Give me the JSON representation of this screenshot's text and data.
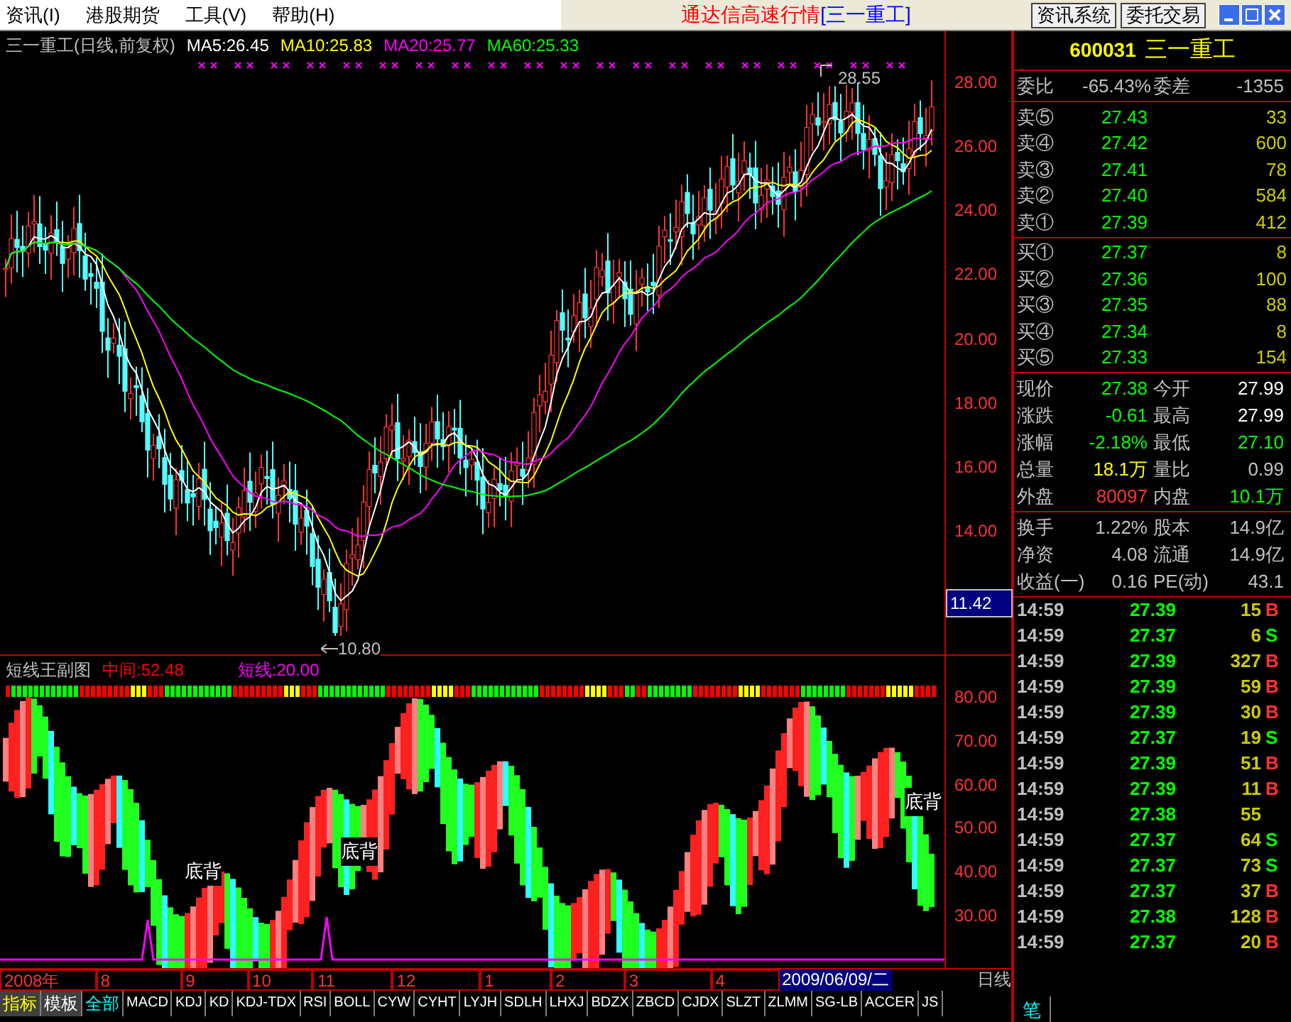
{
  "menu": [
    "资讯(I)",
    "港股期货",
    "工具(V)",
    "帮助(H)"
  ],
  "title": {
    "app": "通达信高速行情",
    "stock": "[三一重工]"
  },
  "toolbar_buttons": [
    "资讯系统",
    "委托交易"
  ],
  "main_chart": {
    "title": "三一重工(日线,前复权)",
    "ma": [
      {
        "label": "MA5:26.45",
        "color": "#ffffff"
      },
      {
        "label": "MA10:25.83",
        "color": "#ffff00"
      },
      {
        "label": "MA20:25.77",
        "color": "#ff00ff"
      },
      {
        "label": "MA60:25.33",
        "color": "#00ff00"
      }
    ],
    "high_label": "28.55",
    "low_label": "10.80",
    "yticks": [
      "28.00",
      "26.00",
      "24.00",
      "22.00",
      "20.00",
      "18.00",
      "16.00",
      "14.00"
    ],
    "cursor_value": "11.42"
  },
  "sub_chart": {
    "title": "短线王副图",
    "values": [
      {
        "label": "中间:52.48",
        "color": "#ff0000"
      },
      {
        "label": "短线:20.00",
        "color": "#ff00ff"
      }
    ],
    "annotations": [
      "底背",
      "底背",
      "底背"
    ],
    "yticks": [
      "80.00",
      "70.00",
      "60.00",
      "50.00",
      "40.00",
      "30.00"
    ]
  },
  "date_axis": {
    "labels": [
      "2008年",
      "8",
      "9",
      "10",
      "11",
      "12",
      "1",
      "2",
      "3",
      "4"
    ],
    "cursor_date": "2009/06/09/二",
    "period": "日线"
  },
  "tabs": [
    {
      "label": "指标",
      "kind": "group",
      "selected": false
    },
    {
      "label": "模板",
      "kind": "group",
      "selected": false
    },
    {
      "label": "全部",
      "kind": "indicator",
      "selected": true
    },
    {
      "label": "MACD",
      "kind": "indicator",
      "selected": false
    },
    {
      "label": "KDJ",
      "kind": "indicator",
      "selected": false
    },
    {
      "label": "KD",
      "kind": "indicator",
      "selected": false
    },
    {
      "label": "KDJ-TDX",
      "kind": "indicator",
      "selected": false
    },
    {
      "label": "RSI",
      "kind": "indicator",
      "selected": false
    },
    {
      "label": "BOLL",
      "kind": "indicator",
      "selected": false
    },
    {
      "label": "CYW",
      "kind": "indicator",
      "selected": false
    },
    {
      "label": "CYHT",
      "kind": "indicator",
      "selected": false
    },
    {
      "label": "LYJH",
      "kind": "indicator",
      "selected": false
    },
    {
      "label": "SDLH",
      "kind": "indicator",
      "selected": false
    },
    {
      "label": "LHXJ",
      "kind": "indicator",
      "selected": false
    },
    {
      "label": "BDZX",
      "kind": "indicator",
      "selected": false
    },
    {
      "label": "ZBCD",
      "kind": "indicator",
      "selected": false
    },
    {
      "label": "CJDX",
      "kind": "indicator",
      "selected": false
    },
    {
      "label": "SLZT",
      "kind": "indicator",
      "selected": false
    },
    {
      "label": "ZLMM",
      "kind": "indicator",
      "selected": false
    },
    {
      "label": "SG-LB",
      "kind": "indicator",
      "selected": false
    },
    {
      "label": "ACCER",
      "kind": "indicator",
      "selected": false
    },
    {
      "label": "JS",
      "kind": "indicator",
      "selected": false
    }
  ],
  "quote": {
    "code": "600031",
    "name": "三一重工",
    "ratio": {
      "label": "委比",
      "value": "-65.43%",
      "label2": "委差",
      "value2": "-1355"
    },
    "asks": [
      {
        "label": "卖⑤",
        "price": "27.43",
        "volume": "33"
      },
      {
        "label": "卖④",
        "price": "27.42",
        "volume": "600"
      },
      {
        "label": "卖③",
        "price": "27.41",
        "volume": "78"
      },
      {
        "label": "卖②",
        "price": "27.40",
        "volume": "584"
      },
      {
        "label": "卖①",
        "price": "27.39",
        "volume": "412"
      }
    ],
    "bids": [
      {
        "label": "买①",
        "price": "27.37",
        "volume": "8"
      },
      {
        "label": "买②",
        "price": "27.36",
        "volume": "100"
      },
      {
        "label": "买③",
        "price": "27.35",
        "volume": "88"
      },
      {
        "label": "买④",
        "price": "27.34",
        "volume": "8"
      },
      {
        "label": "买⑤",
        "price": "27.33",
        "volume": "154"
      }
    ],
    "stats": [
      {
        "left": {
          "label": "现价",
          "value": "27.38",
          "color": "#00ff00"
        },
        "right": {
          "label": "今开",
          "value": "27.99",
          "color": "#ffffff"
        }
      },
      {
        "left": {
          "label": "涨跌",
          "value": "-0.61",
          "color": "#00ff00"
        },
        "right": {
          "label": "最高",
          "value": "27.99",
          "color": "#ffffff"
        }
      },
      {
        "left": {
          "label": "涨幅",
          "value": "-2.18%",
          "color": "#00ff00"
        },
        "right": {
          "label": "最低",
          "value": "27.10",
          "color": "#00ff00"
        }
      },
      {
        "left": {
          "label": "总量",
          "value": "18.1万",
          "color": "#ffff00"
        },
        "right": {
          "label": "量比",
          "value": "0.99",
          "color": "#c0c0c0"
        }
      },
      {
        "left": {
          "label": "外盘",
          "value": "80097",
          "color": "#ff3232"
        },
        "right": {
          "label": "内盘",
          "value": "10.1万",
          "color": "#00ff00"
        }
      }
    ],
    "fundamentals": [
      {
        "label": "换手",
        "value": "1.22%",
        "label2": "股本",
        "value2": "14.9亿"
      },
      {
        "label": "净资",
        "value": "4.08",
        "label2": "流通",
        "value2": "14.9亿"
      },
      {
        "label": "收益(一)",
        "value": "0.16",
        "label2": "PE(动)",
        "value2": "43.1"
      }
    ]
  },
  "ticks": [
    {
      "time": "14:59",
      "price": "27.39",
      "volume": "15",
      "side": "B"
    },
    {
      "time": "14:59",
      "price": "27.37",
      "volume": "6",
      "side": "S"
    },
    {
      "time": "14:59",
      "price": "27.39",
      "volume": "327",
      "side": "B"
    },
    {
      "time": "14:59",
      "price": "27.39",
      "volume": "59",
      "side": "B"
    },
    {
      "time": "14:59",
      "price": "27.39",
      "volume": "30",
      "side": "B"
    },
    {
      "time": "14:59",
      "price": "27.37",
      "volume": "19",
      "side": "S"
    },
    {
      "time": "14:59",
      "price": "27.39",
      "volume": "51",
      "side": "B"
    },
    {
      "time": "14:59",
      "price": "27.39",
      "volume": "11",
      "side": "B"
    },
    {
      "time": "14:59",
      "price": "27.38",
      "volume": "55"
    },
    {
      "time": "14:59",
      "price": "27.37",
      "volume": "64",
      "side": "S"
    },
    {
      "time": "14:59",
      "price": "27.37",
      "volume": "73",
      "side": "S"
    },
    {
      "time": "14:59",
      "price": "27.37",
      "volume": "37",
      "side": "B"
    },
    {
      "time": "14:59",
      "price": "27.38",
      "volume": "128",
      "side": "B"
    },
    {
      "time": "14:59",
      "price": "27.37",
      "volume": "20",
      "side": "B"
    }
  ],
  "panel_tabs": [
    {
      "label": "笔",
      "selected": true
    }
  ]
}
